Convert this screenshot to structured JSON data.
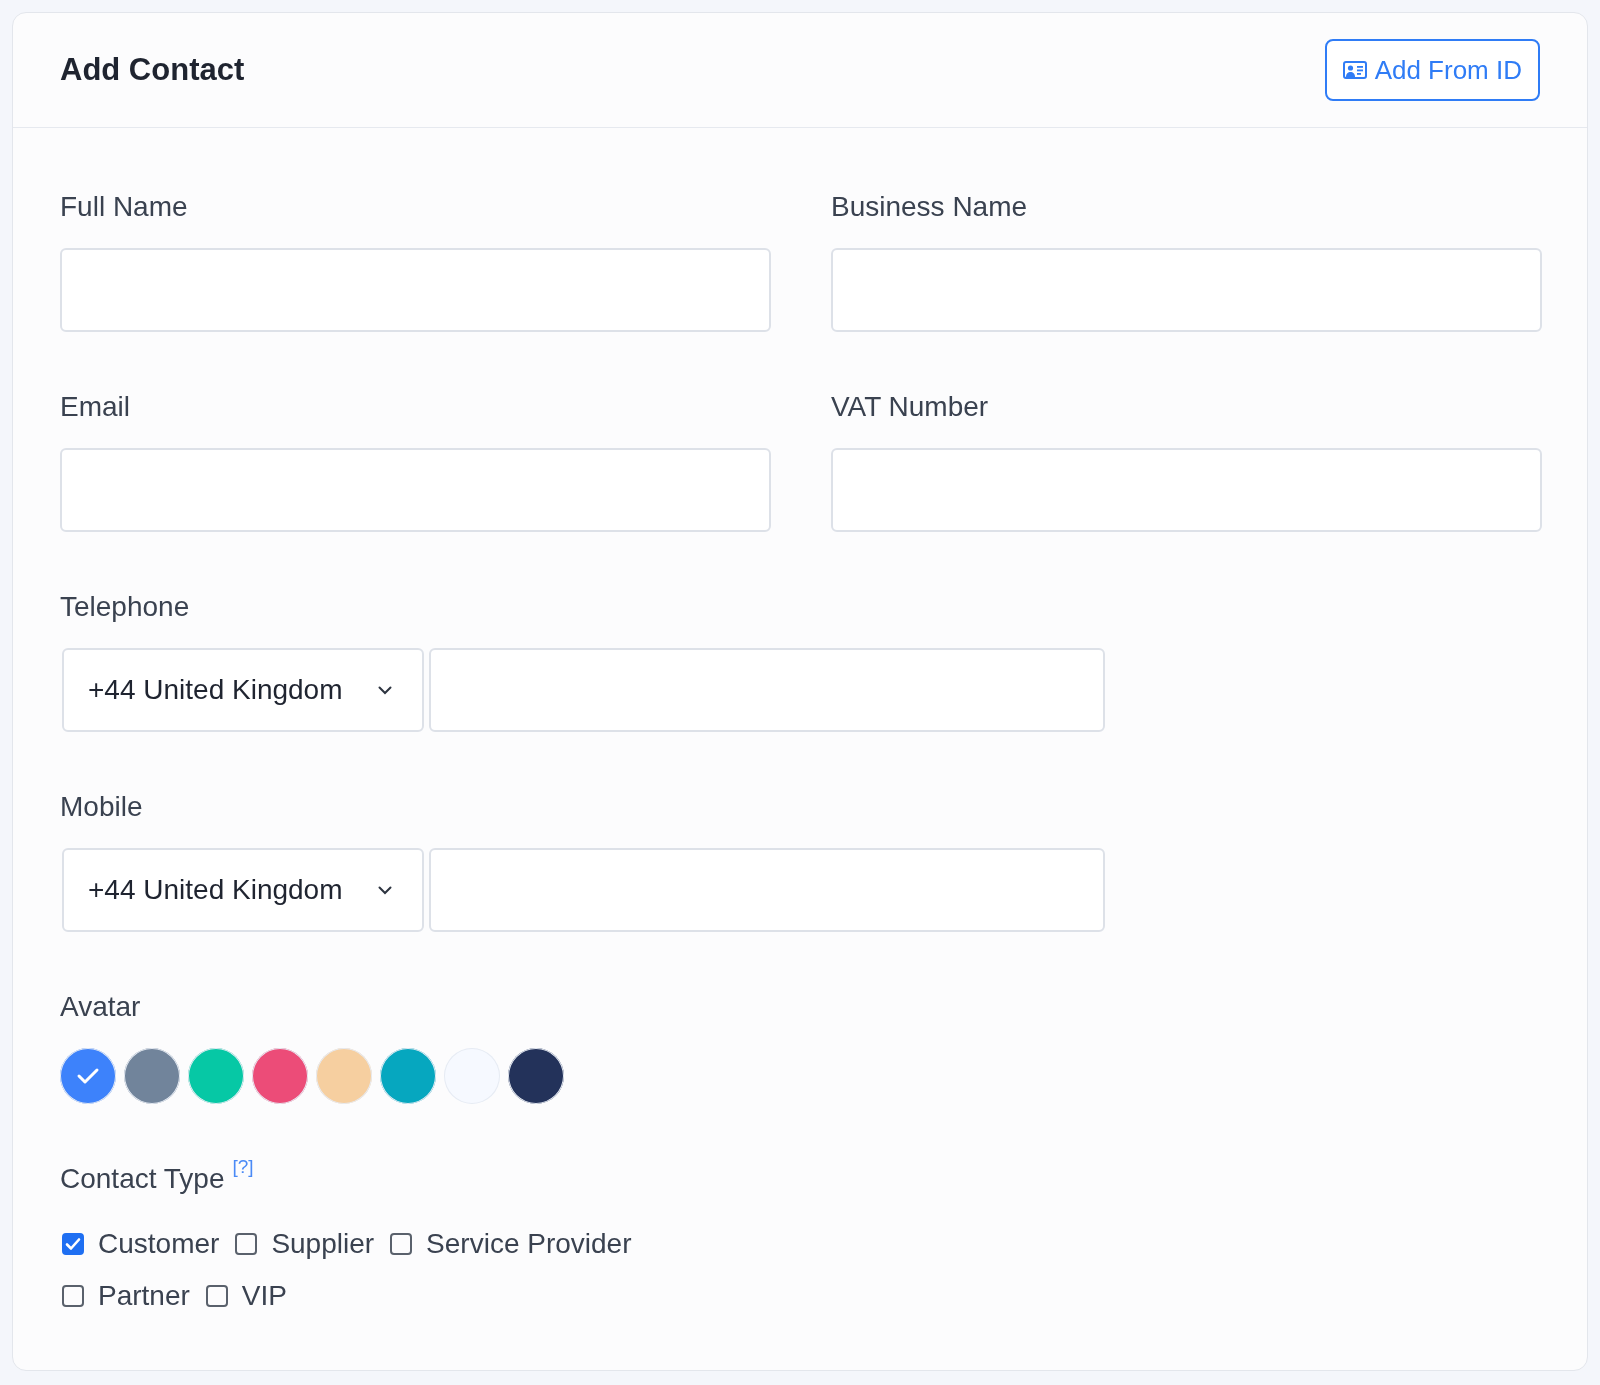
{
  "title": "Add Contact",
  "header_button": {
    "label": "Add From ID"
  },
  "fields": [
    {
      "label": "Full Name",
      "kind": "text"
    },
    {
      "label": "Business Name",
      "kind": "text"
    },
    {
      "label": "Email",
      "kind": "text"
    },
    {
      "label": "VAT Number",
      "kind": "text"
    },
    {
      "label": "Telephone",
      "kind": "phone",
      "country": "+44 United Kingdom"
    },
    {
      "label": "Mobile",
      "kind": "phone",
      "country": "+44 United Kingdom"
    }
  ],
  "avatar": {
    "label": "Avatar",
    "colors": [
      {
        "color": "#3d82fb",
        "selected": true
      },
      {
        "color": "#71849b",
        "selected": false
      },
      {
        "color": "#06c8a5",
        "selected": false
      },
      {
        "color": "#ec4c78",
        "selected": false
      },
      {
        "color": "#f6cfa0",
        "selected": false
      },
      {
        "color": "#06a7bf",
        "selected": false
      },
      {
        "color": "#f6f9ff",
        "selected": false
      },
      {
        "color": "#23325a",
        "selected": false
      }
    ]
  },
  "contact_type": {
    "label": "Contact Type",
    "help": "[?]",
    "options": [
      {
        "label": "Customer",
        "checked": true
      },
      {
        "label": "Supplier",
        "checked": false
      },
      {
        "label": "Service Provider",
        "checked": false
      },
      {
        "label": "Partner",
        "checked": false
      },
      {
        "label": "VIP",
        "checked": false
      }
    ]
  }
}
